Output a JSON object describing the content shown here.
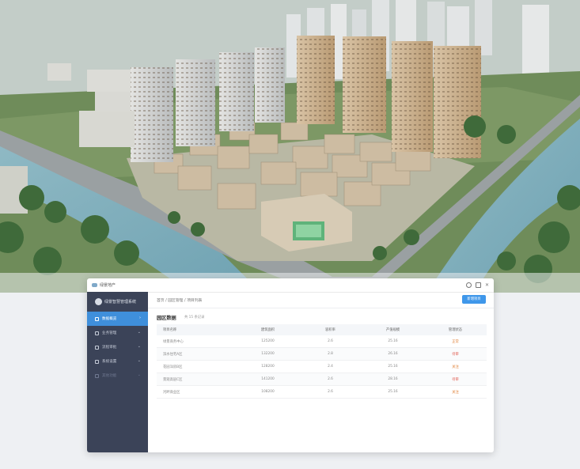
{
  "colors": {
    "accent": "#3f97ea",
    "sidebar": "#3b4358",
    "active": "#3f8fdb",
    "warn": "#e0823a",
    "danger": "#e05a4e"
  },
  "app": {
    "title": "绿景地产",
    "icons": [
      "search-icon",
      "grid-icon",
      "close-icon"
    ]
  },
  "sidebar": {
    "brand": "绿景智慧管理系统",
    "items": [
      {
        "label": "数据概览"
      },
      {
        "label": "业务管理"
      },
      {
        "label": "流程审批"
      },
      {
        "label": "系统设置"
      },
      {
        "label": "其他功能"
      }
    ]
  },
  "main": {
    "breadcrumb": "首页 / 园区管理 / 项目列表",
    "primary_button": "新增项目",
    "section_title": "园区数据",
    "section_sub": "共 15 条记录",
    "table": {
      "headers": [
        "项目名称",
        "建筑面积",
        "容积率",
        "产值规模",
        "管理状态"
      ],
      "rows": [
        {
          "cells": [
            "绿景商务中心",
            "125200",
            "2.6",
            "25.16",
            "正常"
          ],
          "status": "normal"
        },
        {
          "cells": [
            "滨水住宅A区",
            "132200",
            "2.8",
            "26.16",
            "待审"
          ],
          "status": "red"
        },
        {
          "cells": [
            "花园洋房B区",
            "128200",
            "2.4",
            "25.16",
            "关注"
          ],
          "status": "orange"
        },
        {
          "cells": [
            "景观高层C区",
            "141200",
            "2.6",
            "28.16",
            "待审"
          ],
          "status": "red"
        },
        {
          "cells": [
            "河畔商业区",
            "108200",
            "2.6",
            "25.16",
            "关注"
          ],
          "status": "orange"
        }
      ]
    }
  }
}
